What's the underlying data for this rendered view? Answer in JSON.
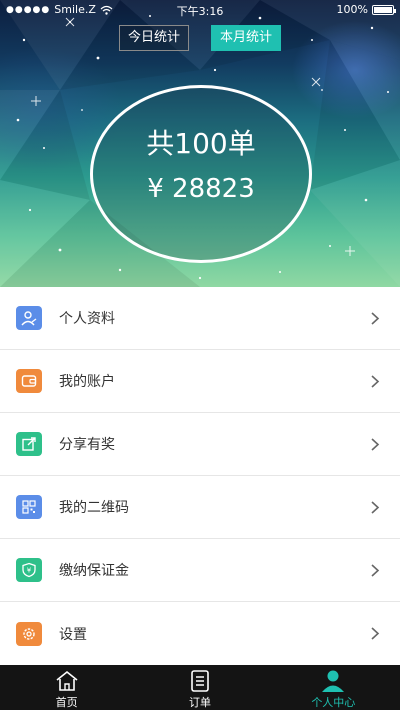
{
  "status_bar": {
    "carrier": "Smile.Z",
    "time": "下午3:16",
    "battery": "100%"
  },
  "stats_tabs": [
    {
      "label": "今日统计",
      "active": false
    },
    {
      "label": "本月统计",
      "active": true
    }
  ],
  "summary": {
    "order_total": "共100单",
    "amount": "¥ 28823"
  },
  "menu": [
    {
      "label": "个人资料",
      "icon": "profile-icon",
      "color": "#5b8de8"
    },
    {
      "label": "我的账户",
      "icon": "wallet-icon",
      "color": "#f08a3c"
    },
    {
      "label": "分享有奖",
      "icon": "share-icon",
      "color": "#2ec08a"
    },
    {
      "label": "我的二维码",
      "icon": "qr-code-icon",
      "color": "#5b8de8"
    },
    {
      "label": "缴纳保证金",
      "icon": "deposit-icon",
      "color": "#2ec08a"
    },
    {
      "label": "设置",
      "icon": "gear-icon",
      "color": "#f08a3c"
    }
  ],
  "bottom_nav": [
    {
      "label": "首页",
      "icon": "home-icon",
      "active": false
    },
    {
      "label": "订单",
      "icon": "orders-icon",
      "active": false
    },
    {
      "label": "个人中心",
      "icon": "user-center-icon",
      "active": true
    }
  ],
  "colors": {
    "accent": "#1fc0b1",
    "bottom_bar": "#141414"
  }
}
